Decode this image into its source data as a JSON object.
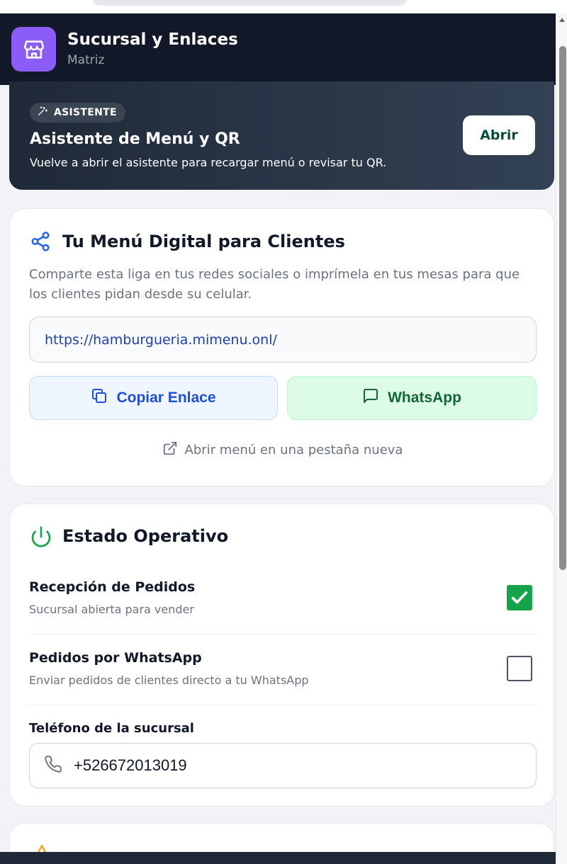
{
  "header": {
    "title": "Sucursal y Enlaces",
    "subtitle": "Matriz",
    "logo_icon": "store-icon",
    "logo_color": "#8b5cf6"
  },
  "assistant": {
    "badge": "ASISTENTE",
    "badge_icon": "magic-wand-icon",
    "title": "Asistente de Menú y QR",
    "description": "Vuelve a abrir el asistente para recargar menú o revisar tu QR.",
    "open_label": "Abrir"
  },
  "menu_card": {
    "icon": "share-icon",
    "title": "Tu Menú Digital para Clientes",
    "description": "Comparte esta liga en tus redes sociales o imprímela en tus mesas para que los clientes pidan desde su celular.",
    "url": "https://hamburgueria.mimenu.onl/",
    "copy_label": "Copiar Enlace",
    "copy_icon": "copy-icon",
    "whatsapp_label": "WhatsApp",
    "whatsapp_icon": "chat-bubble-icon",
    "open_tab_label": "Abrir menú en una pestaña nueva",
    "open_tab_icon": "external-link-icon"
  },
  "estado_card": {
    "icon": "power-icon",
    "title": "Estado Operativo",
    "toggles": [
      {
        "label": "Recepción de Pedidos",
        "sublabel": "Sucursal abierta para vender",
        "checked": true
      },
      {
        "label": "Pedidos por WhatsApp",
        "sublabel": "Enviar pedidos de clientes directo a tu WhatsApp",
        "checked": false
      }
    ],
    "phone_label": "Teléfono de la sucursal",
    "phone_value": "+526672013019",
    "phone_icon": "phone-icon"
  },
  "next_card": {
    "icon": "warning-icon"
  },
  "colors": {
    "header_bg": "#111827",
    "accent_blue": "#1d4ed8",
    "accent_green": "#16a34a"
  }
}
